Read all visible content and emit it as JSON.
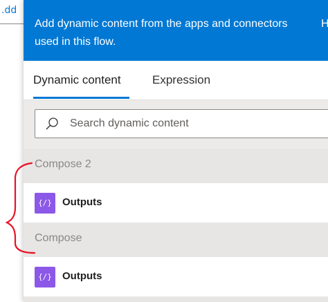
{
  "background": {
    "partial_text": ".dd"
  },
  "header": {
    "text": "Add dynamic content from the apps and connectors used in this flow.",
    "partial_right": "H"
  },
  "tabs": [
    {
      "label": "Dynamic content",
      "active": true
    },
    {
      "label": "Expression",
      "active": false
    }
  ],
  "search": {
    "placeholder": "Search dynamic content",
    "value": ""
  },
  "groups": [
    {
      "title": "Compose 2",
      "items": [
        {
          "label": "Outputs",
          "icon": "compose-icon"
        }
      ]
    },
    {
      "title": "Compose",
      "items": [
        {
          "label": "Outputs",
          "icon": "compose-icon"
        }
      ]
    }
  ],
  "colors": {
    "accent": "#0078d4",
    "item_icon": "#8c58e8",
    "annotation": "#e81123"
  },
  "annotation": {
    "shape": "curly-brace",
    "color": "#e81123"
  }
}
